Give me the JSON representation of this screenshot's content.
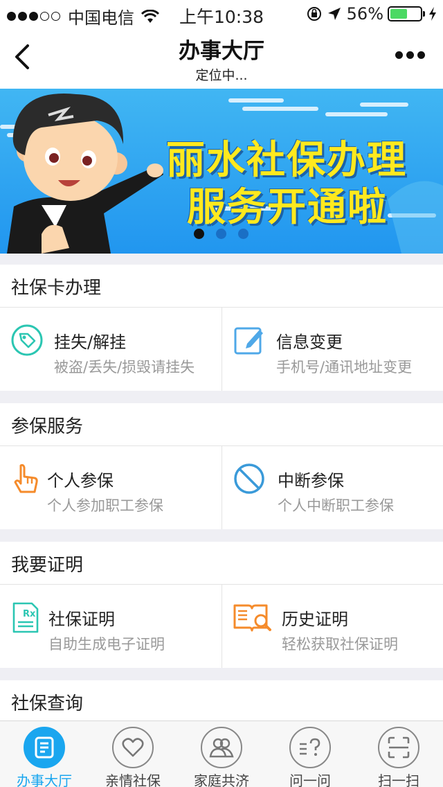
{
  "status_bar": {
    "carrier": "中国电信",
    "time": "上午10:38",
    "battery": "56%",
    "battery_level": 0.56
  },
  "nav": {
    "title": "办事大厅",
    "subtitle": "定位中..."
  },
  "banner": {
    "line1": "丽水社保办理",
    "line2": "服务开通啦",
    "slide_count": 3,
    "active_slide": 1
  },
  "sections": [
    {
      "title": "社保卡办理",
      "items": [
        {
          "title": "挂失/解挂",
          "desc": "被盗/丢失/损毁请挂失",
          "icon": "tag-icon",
          "color": "#2bc6b2"
        },
        {
          "title": "信息变更",
          "desc": "手机号/通讯地址变更",
          "icon": "edit-icon",
          "color": "#4fa8e8"
        }
      ]
    },
    {
      "title": "参保服务",
      "items": [
        {
          "title": "个人参保",
          "desc": "个人参加职工参保",
          "icon": "hand-pointer-icon",
          "color": "#f58b2b"
        },
        {
          "title": "中断参保",
          "desc": "个人中断职工参保",
          "icon": "prohibited-icon",
          "color": "#3a9ad9"
        }
      ]
    },
    {
      "title": "我要证明",
      "items": [
        {
          "title": "社保证明",
          "desc": "自助生成电子证明",
          "icon": "rx-document-icon",
          "color": "#2bc6b2"
        },
        {
          "title": "历史证明",
          "desc": "轻松获取社保证明",
          "icon": "book-search-icon",
          "color": "#f58b2b"
        }
      ]
    },
    {
      "title": "社保查询"
    }
  ],
  "tabbar": [
    {
      "label": "办事大厅",
      "icon": "document-list-icon",
      "active": true
    },
    {
      "label": "亲情社保",
      "icon": "heart-icon",
      "active": false
    },
    {
      "label": "家庭共济",
      "icon": "people-icon",
      "active": false
    },
    {
      "label": "问一问",
      "icon": "question-icon",
      "active": false
    },
    {
      "label": "扫一扫",
      "icon": "scan-icon",
      "active": false
    }
  ],
  "colors": {
    "accent": "#1aa6ef",
    "banner_text": "#ffe91e",
    "banner_bg": "#2196ef"
  }
}
